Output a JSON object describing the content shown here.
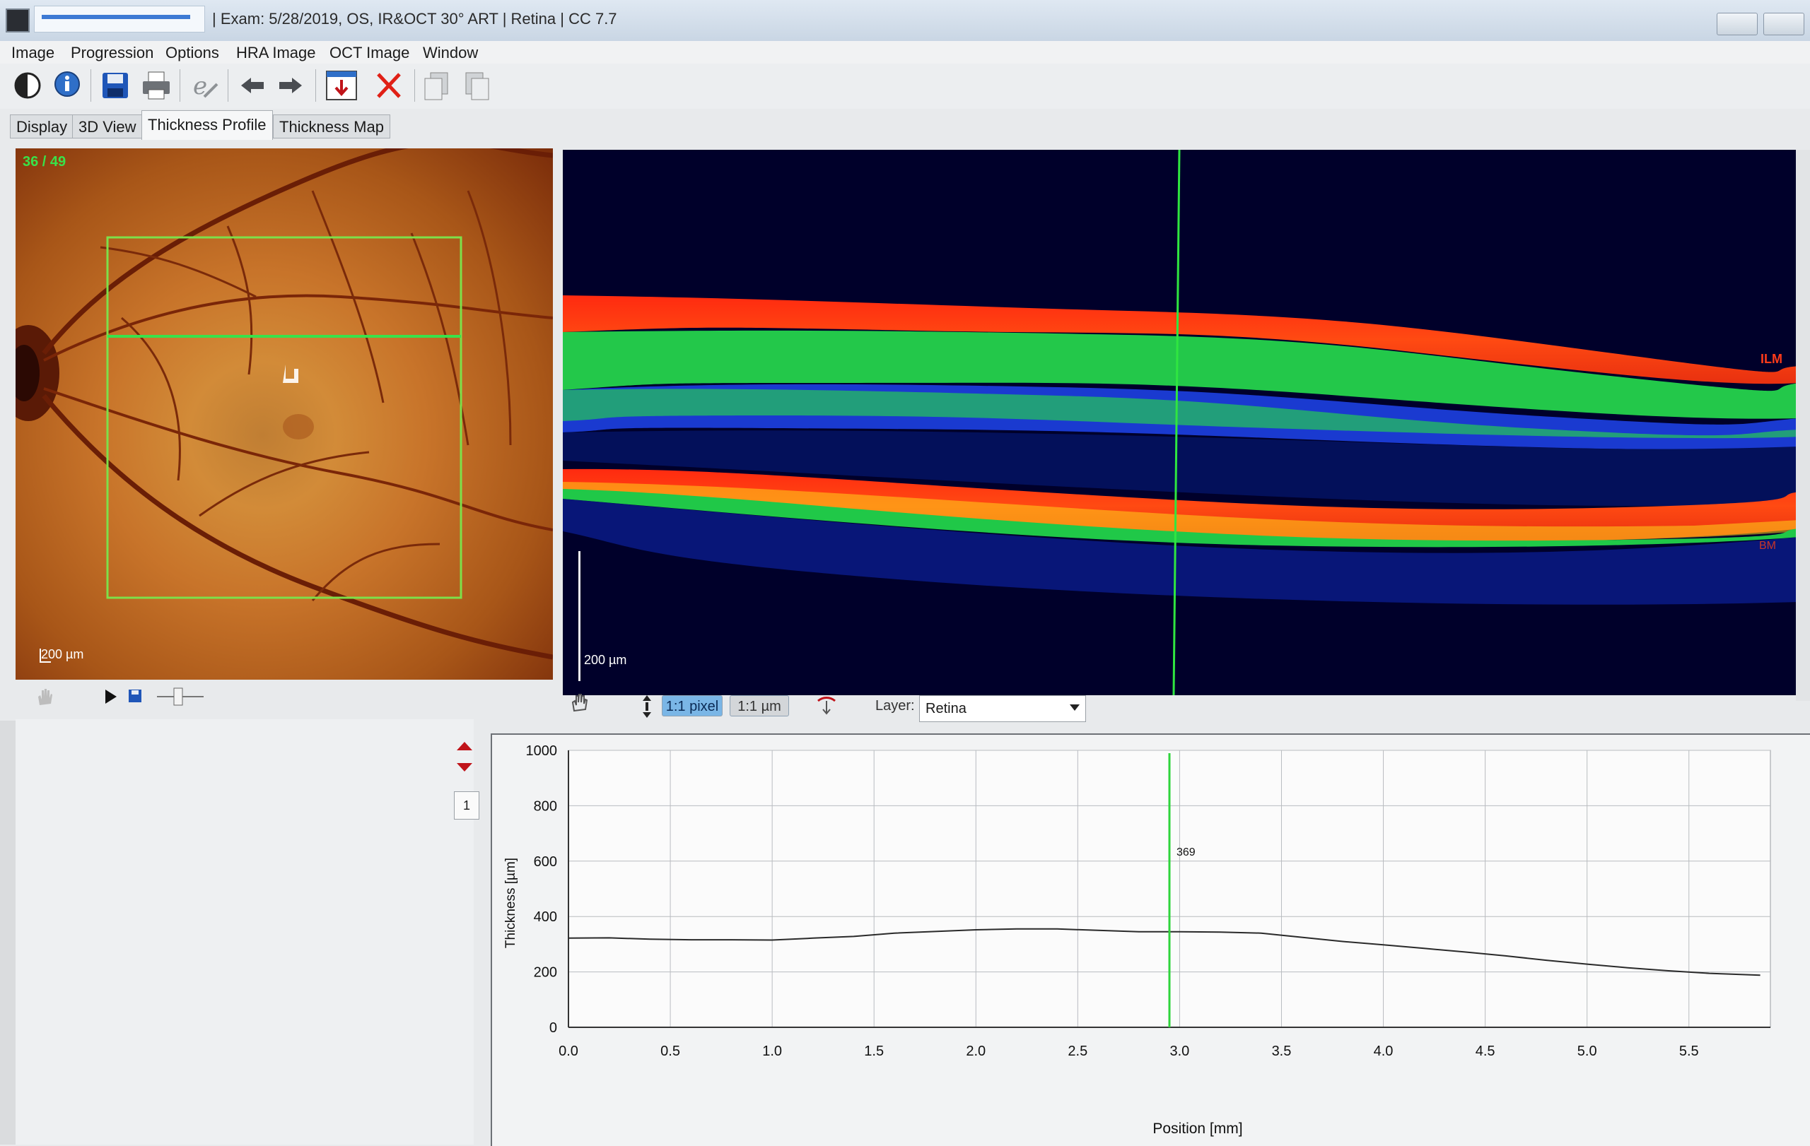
{
  "window": {
    "title": "|  Exam: 5/28/2019, OS, IR&OCT 30° ART  |  Retina  |  CC 7.7"
  },
  "menu": [
    "Image",
    "Progression",
    "Options",
    "HRA Image",
    "OCT Image",
    "Window"
  ],
  "toolbar_icons": [
    "contrast-icon",
    "info-icon",
    "save-icon",
    "print-icon",
    "edit-icon",
    "back-arrow-icon",
    "forward-arrow-icon",
    "export-icon",
    "delete-icon",
    "copy-icon",
    "paste-icon"
  ],
  "tabs": [
    {
      "label": "Display",
      "active": false
    },
    {
      "label": "3D View",
      "active": false
    },
    {
      "label": "Thickness Profile",
      "active": true
    },
    {
      "label": "Thickness Map",
      "active": false
    }
  ],
  "fundus": {
    "counter": "36 / 49",
    "scale_label": "200 µm"
  },
  "oct": {
    "scale_label": "200 µm",
    "ilm_label": "ILM",
    "bm_label": "BM",
    "zoom_1_1_pixel": "1:1 pixel",
    "zoom_1_1_um": "1:1 µm",
    "layer_label": "Layer:",
    "layer_value": "Retina"
  },
  "profile": {
    "page": "1"
  },
  "chart_data": {
    "type": "line",
    "xlabel": "Position [mm]",
    "ylabel": "Thickness [µm]",
    "xlim": [
      0.0,
      5.9
    ],
    "ylim": [
      0,
      1000
    ],
    "x_ticks": [
      "0.0",
      "0.5",
      "1.0",
      "1.5",
      "2.0",
      "2.5",
      "3.0",
      "3.5",
      "4.0",
      "4.5",
      "5.0",
      "5.5"
    ],
    "y_ticks": [
      "0",
      "200",
      "400",
      "600",
      "800",
      "1000"
    ],
    "grid": true,
    "cursor_x": 2.95,
    "cursor_label": "369",
    "series": [
      {
        "x": [
          0.0,
          0.2,
          0.4,
          0.6,
          0.8,
          1.0,
          1.2,
          1.4,
          1.6,
          1.8,
          2.0,
          2.2,
          2.4,
          2.6,
          2.8,
          3.0,
          3.2,
          3.4,
          3.6,
          3.8,
          4.0,
          4.2,
          4.4,
          4.6,
          4.8,
          5.0,
          5.2,
          5.4,
          5.6,
          5.85
        ],
        "y": [
          322,
          323,
          318,
          316,
          316,
          315,
          322,
          328,
          340,
          346,
          352,
          355,
          355,
          350,
          345,
          345,
          344,
          340,
          325,
          310,
          298,
          285,
          272,
          258,
          242,
          228,
          215,
          204,
          195,
          188
        ]
      }
    ]
  }
}
